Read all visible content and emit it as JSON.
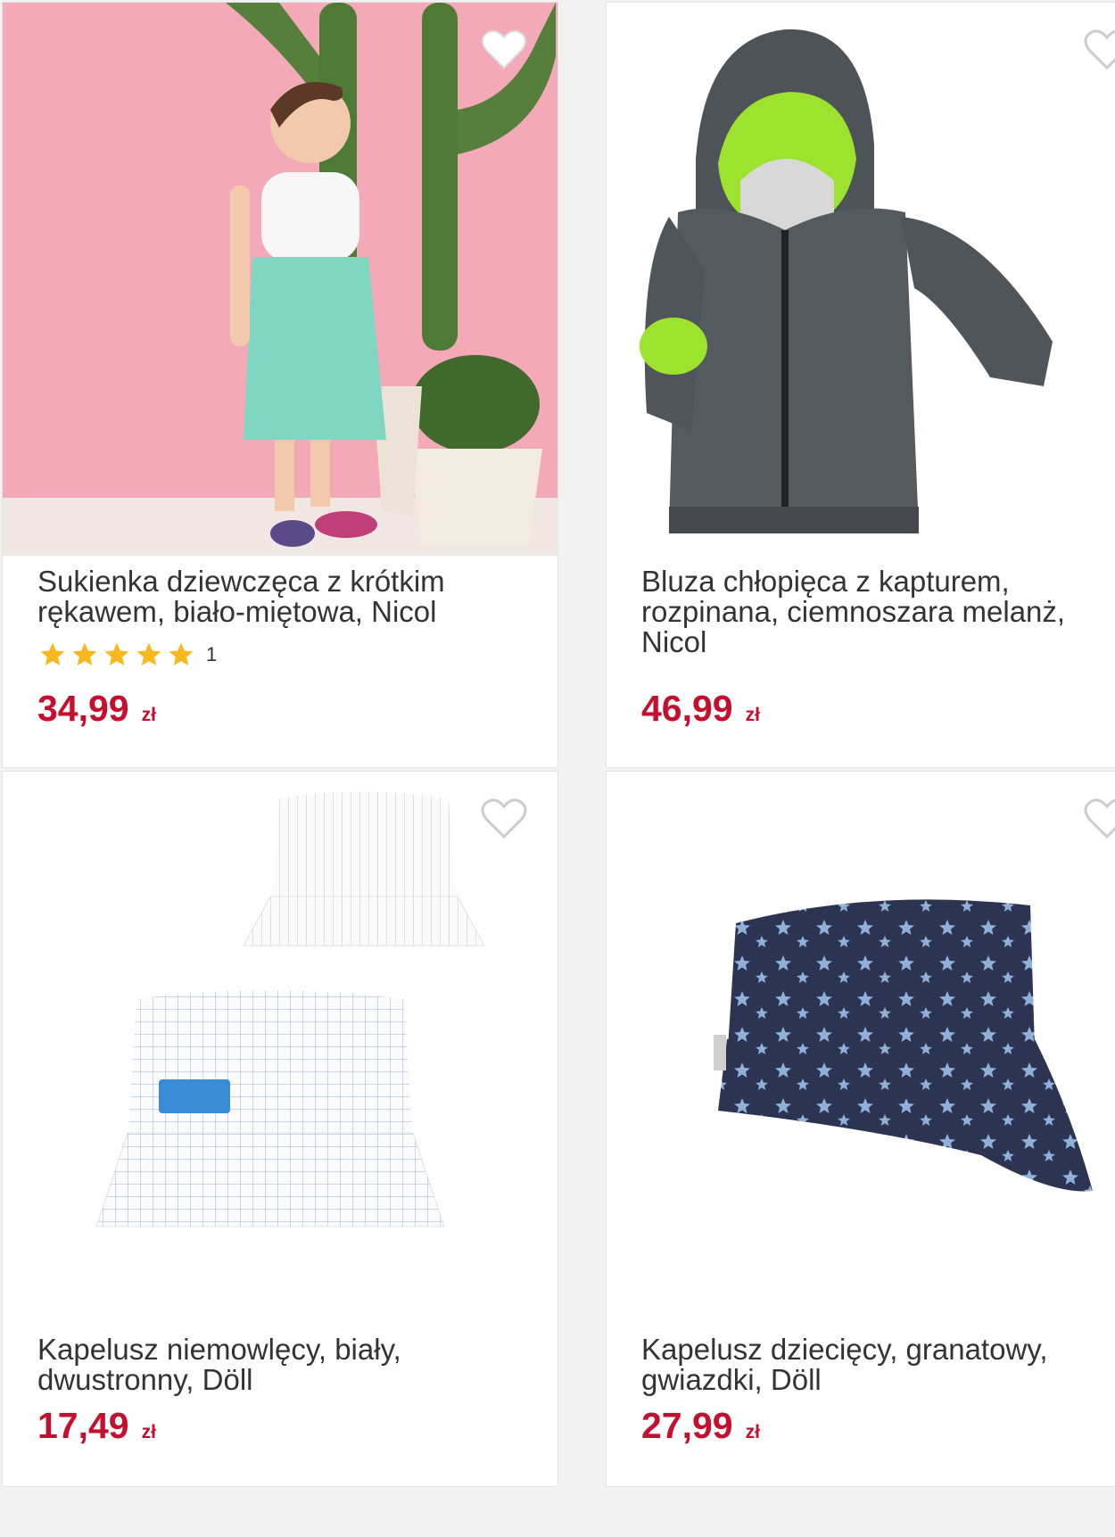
{
  "products": [
    {
      "title": "Sukienka dziewczęca z krótkim rękawem, biało-miętowa, Nicol",
      "rating_count": "1",
      "stars": 5,
      "price": "34,99",
      "currency": "zł",
      "image": "girl-dress-photo",
      "favorite": true
    },
    {
      "title": "Bluza chłopięca z kapturem, rozpinana, ciemnoszara melanż, Nicol",
      "price": "46,99",
      "currency": "zł",
      "image": "grey-hoodie-photo",
      "favorite": false
    },
    {
      "title": "Kapelusz niemowlęcy, biały, dwustronny, Döll",
      "price": "17,49",
      "currency": "zł",
      "image": "white-bucket-hat-photo",
      "favorite": false
    },
    {
      "title": "Kapelusz dziecięcy, granatowy, gwiazdki, Döll",
      "price": "27,99",
      "currency": "zł",
      "image": "navy-star-hat-photo",
      "favorite": false
    }
  ],
  "colors": {
    "price": "#c4102e",
    "star": "#f6b81c",
    "title": "#333333"
  }
}
